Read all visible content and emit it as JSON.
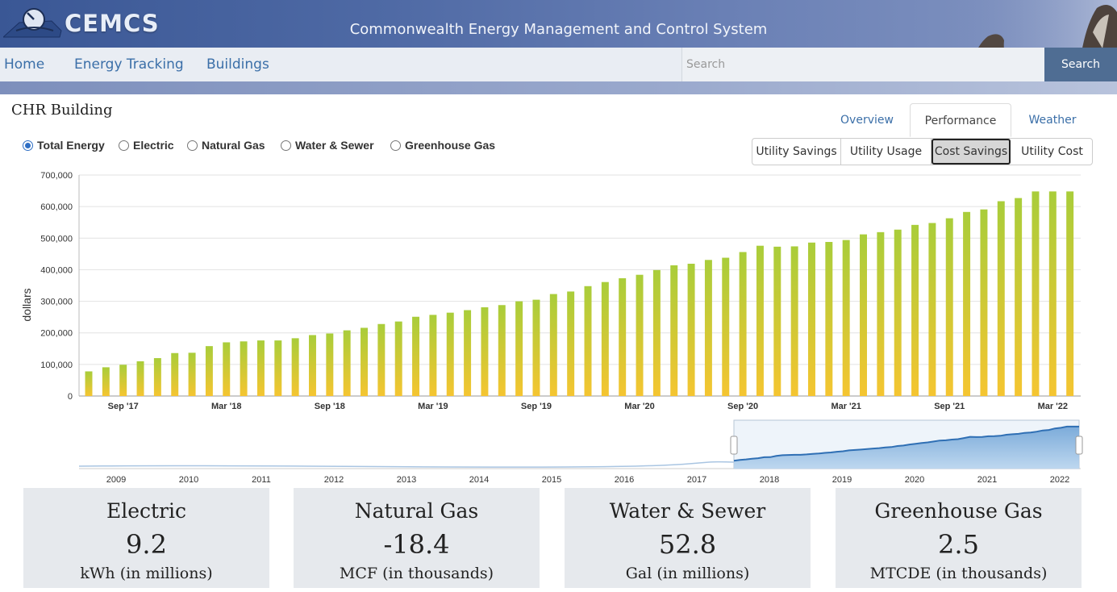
{
  "header": {
    "logo_text": "CEMCS",
    "site_title": "Commonwealth Energy Management and Control System"
  },
  "nav": {
    "items": [
      "Home",
      "Energy Tracking",
      "Buildings"
    ],
    "search_placeholder": "Search",
    "search_button": "Search"
  },
  "page": {
    "title": "CHR Building",
    "tabs": [
      {
        "label": "Overview",
        "active": false
      },
      {
        "label": "Performance",
        "active": true
      },
      {
        "label": "Weather",
        "active": false
      }
    ],
    "radios": [
      {
        "label": "Total Energy",
        "checked": true
      },
      {
        "label": "Electric",
        "checked": false
      },
      {
        "label": "Natural Gas",
        "checked": false
      },
      {
        "label": "Water & Sewer",
        "checked": false
      },
      {
        "label": "Greenhouse Gas",
        "checked": false
      }
    ],
    "views": [
      {
        "label": "Utility Savings",
        "active": false
      },
      {
        "label": "Utility Usage",
        "active": false
      },
      {
        "label": "Cost Savings",
        "active": true
      },
      {
        "label": "Utility Cost",
        "active": false
      }
    ]
  },
  "chart_data": {
    "type": "bar",
    "ylabel": "dollars",
    "ylim": [
      0,
      700000
    ],
    "yticks": [
      "0",
      "100,000",
      "200,000",
      "300,000",
      "400,000",
      "500,000",
      "600,000",
      "700,000"
    ],
    "xtick_labels": [
      "Sep '17",
      "Mar '18",
      "Sep '18",
      "Mar '19",
      "Sep '19",
      "Mar '20",
      "Sep '20",
      "Mar '21",
      "Sep '21",
      "Mar '22"
    ],
    "bar_colors": {
      "top": "#a9cd3a",
      "bottom": "#f5c531"
    },
    "x_start": "Jul 2017",
    "values": [
      78000,
      91000,
      99000,
      110000,
      120000,
      136000,
      137000,
      158000,
      170000,
      173000,
      176000,
      176000,
      183000,
      193000,
      198000,
      208000,
      216000,
      228000,
      236000,
      251000,
      257000,
      264000,
      272000,
      281000,
      288000,
      300000,
      305000,
      323000,
      331000,
      348000,
      361000,
      373000,
      384000,
      399000,
      414000,
      419000,
      431000,
      438000,
      456000,
      476000,
      473000,
      474000,
      486000,
      488000,
      494000,
      512000,
      519000,
      527000,
      542000,
      548000,
      563000,
      583000,
      591000,
      617000,
      627000,
      648000,
      648000,
      648000
    ],
    "navigator": {
      "type": "area",
      "x_labels": [
        "2009",
        "2010",
        "2011",
        "2012",
        "2013",
        "2014",
        "2015",
        "2016",
        "2017",
        "2018",
        "2019",
        "2020",
        "2021",
        "2022"
      ],
      "selected_range": [
        "2017",
        "2022"
      ]
    }
  },
  "stats": [
    {
      "title": "Electric",
      "value": "9.2",
      "unit": "kWh (in millions)"
    },
    {
      "title": "Natural Gas",
      "value": "-18.4",
      "unit": "MCF (in thousands)"
    },
    {
      "title": "Water & Sewer",
      "value": "52.8",
      "unit": "Gal (in millions)"
    },
    {
      "title": "Greenhouse Gas",
      "value": "2.5",
      "unit": "MTCDE (in thousands)"
    }
  ]
}
